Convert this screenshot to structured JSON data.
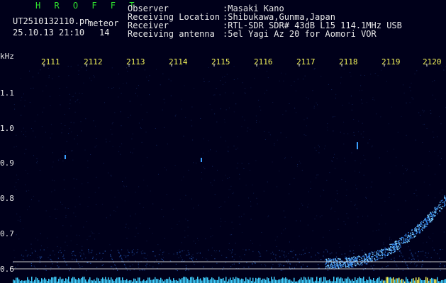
{
  "header": {
    "logo": "H R O F F T",
    "file_name": "UT2510132110.pn",
    "file_suffix": "meteor",
    "datetime": "25.10.13 21:10",
    "frame_count": "14"
  },
  "info": [
    {
      "key": "Observer",
      "value": ":Masaki Kano"
    },
    {
      "key": "Receiving Location",
      "value": ":Shibukawa,Gunma,Japan"
    },
    {
      "key": "Receiver",
      "value": ":RTL-SDR SDR# 43dB L15 114.1MHz USB"
    },
    {
      "key": "Receiving antenna",
      "value": ":5el Yagi Az 20 for Aomori VOR"
    }
  ],
  "spectrogram": {
    "unit_label": "kHz",
    "time_ticks": [
      "2111",
      "2112",
      "2113",
      "2114",
      "2115",
      "2116",
      "2117",
      "2118",
      "2119",
      "2120"
    ],
    "freq_ticks": [
      "1.1",
      "1.0",
      "0.9",
      "0.8",
      "0.7",
      "0.6"
    ],
    "colors": {
      "background": "#00001a",
      "text_white": "#e8e8e8",
      "text_green": "#2fe02f",
      "text_yellow": "#f2f25a",
      "signal": "#3aa0ff",
      "baseline_line": "#c8c8c8"
    }
  }
}
